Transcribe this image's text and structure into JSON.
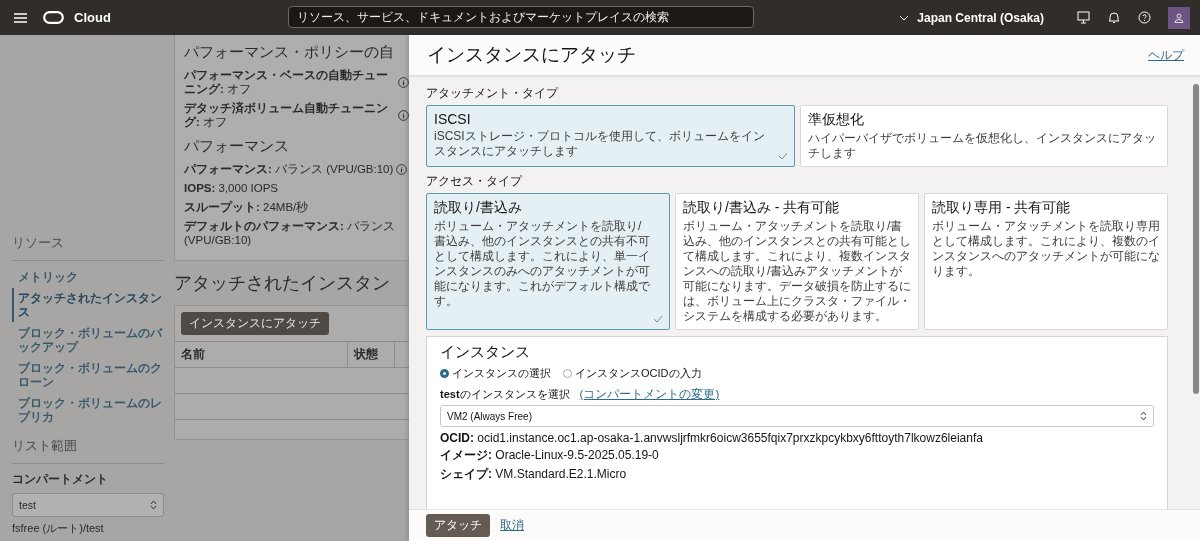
{
  "top_bar": {
    "brand": "Cloud",
    "search_placeholder": "リソース、サービス、ドキュメントおよびマーケットプレイスの検索",
    "region": "Japan Central (Osaka)"
  },
  "background_page": {
    "sections": [
      {
        "title": "パフォーマンス・ポリシーの自",
        "fields": [
          {
            "label": "パフォーマンス・ベースの自動チューニング:",
            "value": "オフ",
            "info": true
          },
          {
            "label": "デタッチ済ボリューム自動チューニング:",
            "value": "オフ",
            "info": true
          }
        ]
      },
      {
        "title": "パフォーマンス",
        "fields": [
          {
            "label": "パフォーマンス:",
            "value": "バランス (VPU/GB:10)",
            "info": true
          },
          {
            "label": "IOPS:",
            "value": "3,000 IOPS",
            "info": false
          },
          {
            "label": "スループット:",
            "value": "24MB/秒",
            "info": false
          },
          {
            "label": "デフォルトのパフォーマンス:",
            "value": "バランス (VPU/GB:10)",
            "info": false
          }
        ]
      }
    ],
    "sidebar": {
      "resources_title": "リソース",
      "items": [
        {
          "label": "メトリック",
          "selected": false
        },
        {
          "label": "アタッチされたインスタンス",
          "selected": true
        },
        {
          "label": "ブロック・ボリュームのバックアップ",
          "selected": false
        },
        {
          "label": "ブロック・ボリュームのクローン",
          "selected": false
        },
        {
          "label": "ブロック・ボリュームのレプリカ",
          "selected": false
        }
      ],
      "scope_title": "リスト範囲",
      "compartment_label": "コンパートメント",
      "compartment_value": "test",
      "compartment_path": "fsfree (ルート)/test"
    },
    "attached": {
      "title": "アタッチされたインスタン",
      "button": "インスタンスにアタッチ",
      "columns": [
        "名前",
        "状態"
      ]
    }
  },
  "drawer": {
    "title": "インスタンスにアタッチ",
    "help": "ヘルプ",
    "attachment_type": {
      "label": "アタッチメント・タイプ",
      "options": [
        {
          "title": "ISCSI",
          "description": "iSCSIストレージ・プロトコルを使用して、ボリュームをインスタンスにアタッチします",
          "selected": true
        },
        {
          "title": "準仮想化",
          "description": "ハイパーバイザでボリュームを仮想化し、インスタンスにアタッチします",
          "selected": false
        }
      ]
    },
    "access_type": {
      "label": "アクセス・タイプ",
      "options": [
        {
          "title": "読取り/書込み",
          "description": "ボリューム・アタッチメントを読取り/書込み、他のインスタンスとの共有不可として構成します。これにより、単一インスタンスのみへのアタッチメントが可能になります。これがデフォルト構成です。",
          "selected": true
        },
        {
          "title": "読取り/書込み - 共有可能",
          "description": "ボリューム・アタッチメントを読取り/書込み、他のインスタンスとの共有可能として構成します。これにより、複数インスタンスへの読取り/書込みアタッチメントが可能になります。データ破損を防止するには、ボリューム上にクラスタ・ファイル・システムを構成する必要があります。",
          "selected": false
        },
        {
          "title": "読取り専用 - 共有可能",
          "description": "ボリューム・アタッチメントを読取り専用として構成します。これにより、複数のインスタンスへのアタッチメントが可能になります。",
          "selected": false
        }
      ]
    },
    "instance": {
      "title": "インスタンス",
      "modes": [
        {
          "label": "インスタンスの選択",
          "selected": true
        },
        {
          "label": "インスタンスOCIDの入力",
          "selected": false
        }
      ],
      "select_label": "**test**のインスタンスを選択",
      "change_link": "(コンパートメントの変更)",
      "select_value": "VM2 (Always Free)",
      "details": [
        {
          "label": "OCID:",
          "value": "ocid1.instance.oc1.ap-osaka-1.anvwsljrfmkr6oicw3655fqix7prxzkpcykbxy6fttoyth7lkowz6leianfa"
        },
        {
          "label": "イメージ:",
          "value": "Oracle-Linux-9.5-2025.05.19-0"
        },
        {
          "label": "シェイプ:",
          "value": "VM.Standard.E2.1.Micro"
        }
      ]
    },
    "footer": {
      "primary": "アタッチ",
      "cancel": "取消"
    }
  }
}
